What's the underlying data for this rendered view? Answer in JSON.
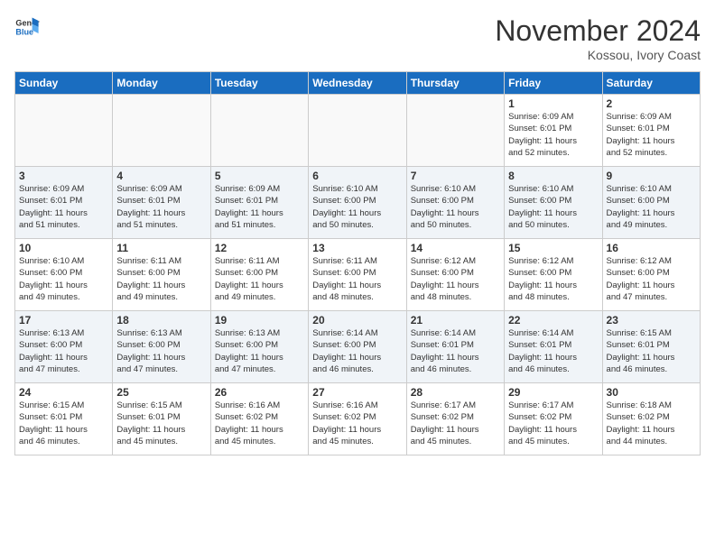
{
  "header": {
    "logo_line1": "General",
    "logo_line2": "Blue",
    "month_title": "November 2024",
    "location": "Kossou, Ivory Coast"
  },
  "days_of_week": [
    "Sunday",
    "Monday",
    "Tuesday",
    "Wednesday",
    "Thursday",
    "Friday",
    "Saturday"
  ],
  "weeks": [
    [
      {
        "day": "",
        "info": "",
        "empty": true
      },
      {
        "day": "",
        "info": "",
        "empty": true
      },
      {
        "day": "",
        "info": "",
        "empty": true
      },
      {
        "day": "",
        "info": "",
        "empty": true
      },
      {
        "day": "",
        "info": "",
        "empty": true
      },
      {
        "day": "1",
        "info": "Sunrise: 6:09 AM\nSunset: 6:01 PM\nDaylight: 11 hours\nand 52 minutes.",
        "empty": false
      },
      {
        "day": "2",
        "info": "Sunrise: 6:09 AM\nSunset: 6:01 PM\nDaylight: 11 hours\nand 52 minutes.",
        "empty": false
      }
    ],
    [
      {
        "day": "3",
        "info": "Sunrise: 6:09 AM\nSunset: 6:01 PM\nDaylight: 11 hours\nand 51 minutes.",
        "empty": false
      },
      {
        "day": "4",
        "info": "Sunrise: 6:09 AM\nSunset: 6:01 PM\nDaylight: 11 hours\nand 51 minutes.",
        "empty": false
      },
      {
        "day": "5",
        "info": "Sunrise: 6:09 AM\nSunset: 6:01 PM\nDaylight: 11 hours\nand 51 minutes.",
        "empty": false
      },
      {
        "day": "6",
        "info": "Sunrise: 6:10 AM\nSunset: 6:00 PM\nDaylight: 11 hours\nand 50 minutes.",
        "empty": false
      },
      {
        "day": "7",
        "info": "Sunrise: 6:10 AM\nSunset: 6:00 PM\nDaylight: 11 hours\nand 50 minutes.",
        "empty": false
      },
      {
        "day": "8",
        "info": "Sunrise: 6:10 AM\nSunset: 6:00 PM\nDaylight: 11 hours\nand 50 minutes.",
        "empty": false
      },
      {
        "day": "9",
        "info": "Sunrise: 6:10 AM\nSunset: 6:00 PM\nDaylight: 11 hours\nand 49 minutes.",
        "empty": false
      }
    ],
    [
      {
        "day": "10",
        "info": "Sunrise: 6:10 AM\nSunset: 6:00 PM\nDaylight: 11 hours\nand 49 minutes.",
        "empty": false
      },
      {
        "day": "11",
        "info": "Sunrise: 6:11 AM\nSunset: 6:00 PM\nDaylight: 11 hours\nand 49 minutes.",
        "empty": false
      },
      {
        "day": "12",
        "info": "Sunrise: 6:11 AM\nSunset: 6:00 PM\nDaylight: 11 hours\nand 49 minutes.",
        "empty": false
      },
      {
        "day": "13",
        "info": "Sunrise: 6:11 AM\nSunset: 6:00 PM\nDaylight: 11 hours\nand 48 minutes.",
        "empty": false
      },
      {
        "day": "14",
        "info": "Sunrise: 6:12 AM\nSunset: 6:00 PM\nDaylight: 11 hours\nand 48 minutes.",
        "empty": false
      },
      {
        "day": "15",
        "info": "Sunrise: 6:12 AM\nSunset: 6:00 PM\nDaylight: 11 hours\nand 48 minutes.",
        "empty": false
      },
      {
        "day": "16",
        "info": "Sunrise: 6:12 AM\nSunset: 6:00 PM\nDaylight: 11 hours\nand 47 minutes.",
        "empty": false
      }
    ],
    [
      {
        "day": "17",
        "info": "Sunrise: 6:13 AM\nSunset: 6:00 PM\nDaylight: 11 hours\nand 47 minutes.",
        "empty": false
      },
      {
        "day": "18",
        "info": "Sunrise: 6:13 AM\nSunset: 6:00 PM\nDaylight: 11 hours\nand 47 minutes.",
        "empty": false
      },
      {
        "day": "19",
        "info": "Sunrise: 6:13 AM\nSunset: 6:00 PM\nDaylight: 11 hours\nand 47 minutes.",
        "empty": false
      },
      {
        "day": "20",
        "info": "Sunrise: 6:14 AM\nSunset: 6:00 PM\nDaylight: 11 hours\nand 46 minutes.",
        "empty": false
      },
      {
        "day": "21",
        "info": "Sunrise: 6:14 AM\nSunset: 6:01 PM\nDaylight: 11 hours\nand 46 minutes.",
        "empty": false
      },
      {
        "day": "22",
        "info": "Sunrise: 6:14 AM\nSunset: 6:01 PM\nDaylight: 11 hours\nand 46 minutes.",
        "empty": false
      },
      {
        "day": "23",
        "info": "Sunrise: 6:15 AM\nSunset: 6:01 PM\nDaylight: 11 hours\nand 46 minutes.",
        "empty": false
      }
    ],
    [
      {
        "day": "24",
        "info": "Sunrise: 6:15 AM\nSunset: 6:01 PM\nDaylight: 11 hours\nand 46 minutes.",
        "empty": false
      },
      {
        "day": "25",
        "info": "Sunrise: 6:15 AM\nSunset: 6:01 PM\nDaylight: 11 hours\nand 45 minutes.",
        "empty": false
      },
      {
        "day": "26",
        "info": "Sunrise: 6:16 AM\nSunset: 6:02 PM\nDaylight: 11 hours\nand 45 minutes.",
        "empty": false
      },
      {
        "day": "27",
        "info": "Sunrise: 6:16 AM\nSunset: 6:02 PM\nDaylight: 11 hours\nand 45 minutes.",
        "empty": false
      },
      {
        "day": "28",
        "info": "Sunrise: 6:17 AM\nSunset: 6:02 PM\nDaylight: 11 hours\nand 45 minutes.",
        "empty": false
      },
      {
        "day": "29",
        "info": "Sunrise: 6:17 AM\nSunset: 6:02 PM\nDaylight: 11 hours\nand 45 minutes.",
        "empty": false
      },
      {
        "day": "30",
        "info": "Sunrise: 6:18 AM\nSunset: 6:02 PM\nDaylight: 11 hours\nand 44 minutes.",
        "empty": false
      }
    ]
  ]
}
